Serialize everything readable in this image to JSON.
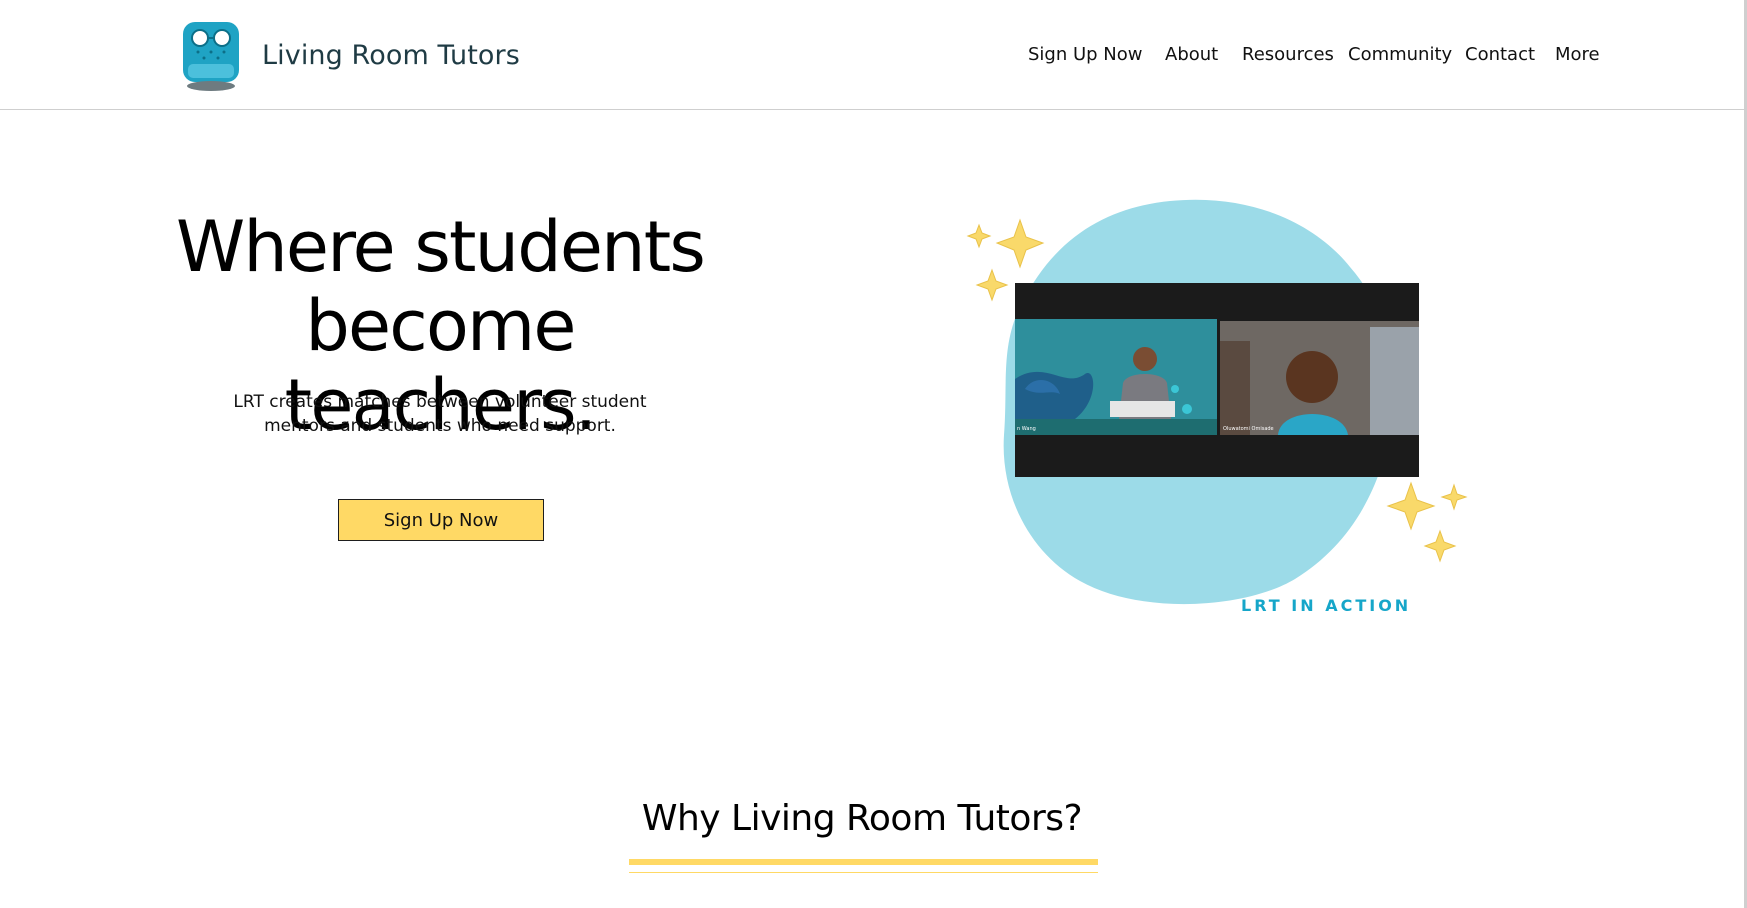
{
  "brand": {
    "name": "Living Room Tutors",
    "logo_icon": "armchair-with-glasses-icon"
  },
  "nav": {
    "items": [
      {
        "label": "Sign Up Now"
      },
      {
        "label": "About"
      },
      {
        "label": "Resources"
      },
      {
        "label": "Community"
      },
      {
        "label": "Contact"
      },
      {
        "label": "More"
      }
    ]
  },
  "hero": {
    "title_line1": "Where students",
    "title_line2": "become teachers.",
    "subtitle_line1": "LRT creates matches between volunteer student",
    "subtitle_line2": "mentors and students who need support.",
    "cta_label": "Sign Up Now"
  },
  "illustration": {
    "caption": "LRT IN ACTION",
    "video_name_left": "n Wang",
    "video_name_right": "Oluwatomi Omisade"
  },
  "why": {
    "title": "Why Living Room Tutors?"
  },
  "colors": {
    "accent_yellow": "#ffd965",
    "blob_blue": "#9cdbe8",
    "caption_blue": "#16a6c9",
    "logo_teal": "#1fa3c4",
    "sparkle_yellow": "#f9d96a"
  }
}
